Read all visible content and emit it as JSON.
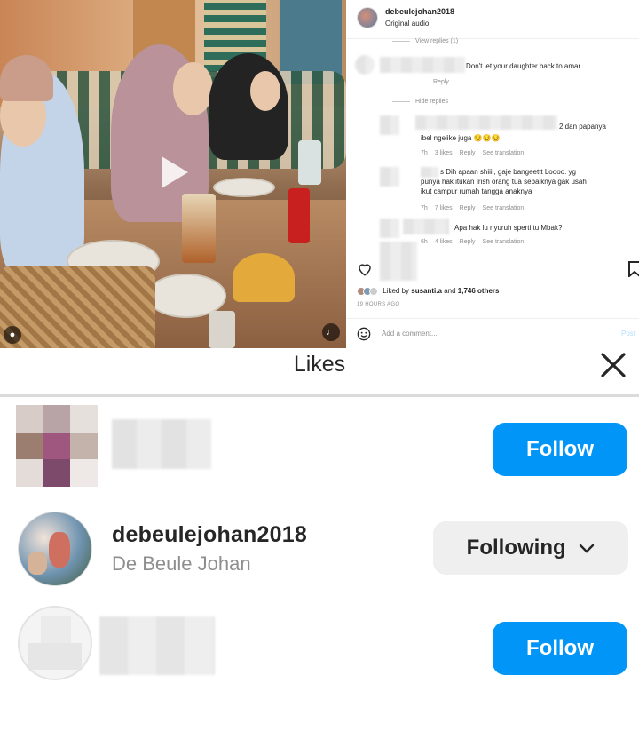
{
  "post": {
    "username": "debeulejohan2018",
    "audio": "Original audio",
    "view_replies": "View replies (1)",
    "hide_replies": "Hide replies",
    "comments": [
      {
        "text": "Don't let your daughter back to amar.",
        "meta": "Reply"
      },
      {
        "text_line1": "2 dan papanya",
        "text_line2": "ibel ngelike juga 😒😒😒",
        "time": "7h",
        "likes": "3 likes",
        "reply": "Reply",
        "see": "See translation"
      },
      {
        "text_line1": "s Dih apaan shiiii, gaje bangeettt Loooo. yg",
        "text_line2": "punya hak itukan Irish orang tua sebaiknya gak usah",
        "text_line3": "ikut campur rumah tangga anaknya",
        "time": "7h",
        "likes": "7 likes",
        "reply": "Reply",
        "see": "See translation"
      },
      {
        "text_line1": "Apa hak lu nyuruh sperti tu Mbak?",
        "time": "6h",
        "likes": "4 likes",
        "reply": "Reply",
        "see": "See translation"
      }
    ],
    "liked_by_prefix": "Liked by",
    "liked_by_user": "susanti.a",
    "liked_by_and": "and",
    "liked_by_count": "1,746 others",
    "time_ago": "19 HOURS AGO",
    "add_comment_placeholder": "Add a comment...",
    "post_label": "Post"
  },
  "likes_dialog": {
    "title": "Likes",
    "users": [
      {
        "username": "",
        "fullname": "",
        "button": "Follow"
      },
      {
        "username": "debeulejohan2018",
        "fullname": "De Beule Johan",
        "button": "Following"
      },
      {
        "username": "",
        "fullname": "",
        "button": "Follow"
      }
    ]
  },
  "colors": {
    "follow_blue": "#0095f6",
    "following_gray": "#efefef",
    "secondary_text": "#8e8e8e"
  },
  "icons": [
    "heart-icon",
    "bookmark-icon",
    "smile-icon",
    "close-icon",
    "chevron-down-icon",
    "play-icon",
    "mute-icon",
    "user-icon"
  ]
}
